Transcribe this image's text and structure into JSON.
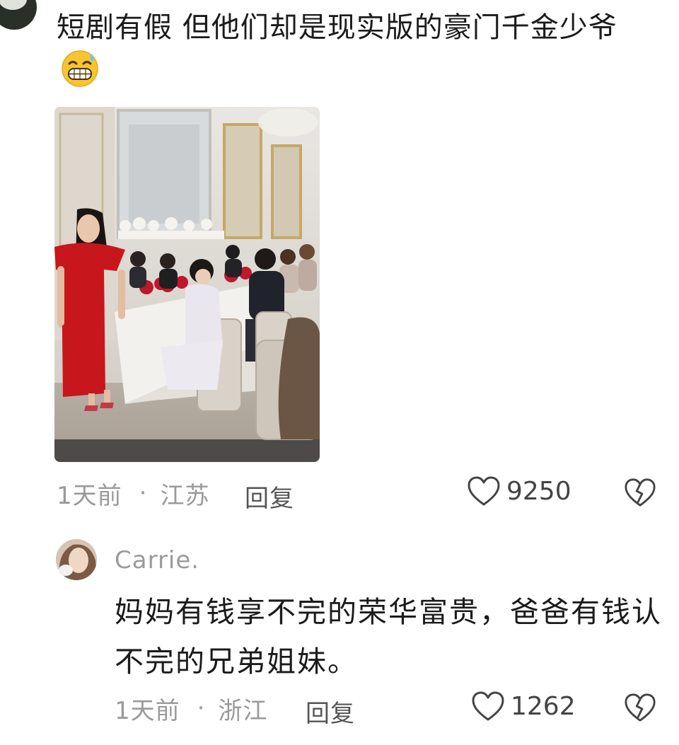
{
  "comment": {
    "text": "短剧有假 但他们却是现实版的豪门千金少爷",
    "emoji_icon": "grinning-sweat-emoji",
    "time": "1天前",
    "separator": "·",
    "location": "江苏",
    "reply_label": "回复",
    "likes": "9250"
  },
  "reply": {
    "username": "Carrie.",
    "text": "妈妈有钱享不完的荣华富贵，爸爸有钱认不完的兄弟姐妹。",
    "time": "1天前",
    "separator": "·",
    "location": "浙江",
    "reply_label": "回复",
    "likes": "1262"
  },
  "icons": {
    "like": "heart-outline-icon",
    "dislike": "broken-heart-icon"
  },
  "colors": {
    "text": "#1b1b1b",
    "meta": "#9a9a9a",
    "dress": "#c8161d"
  }
}
